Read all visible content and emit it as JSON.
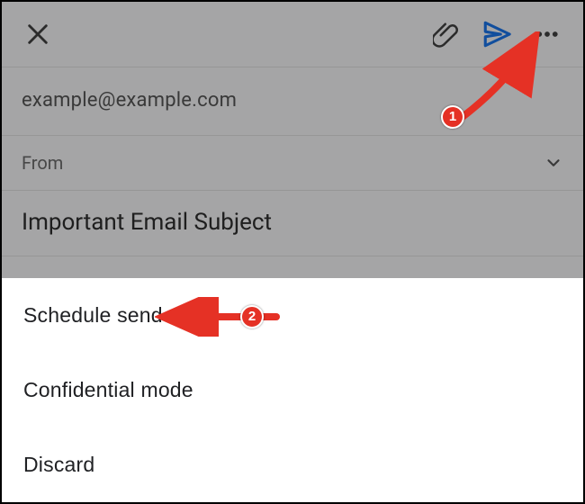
{
  "toolbar": {
    "close_icon": "close",
    "attach_icon": "attachment",
    "send_icon": "send",
    "more_icon": "more"
  },
  "fields": {
    "to": "example@example.com",
    "from_label": "From",
    "subject": "Important Email Subject"
  },
  "menu": {
    "items": [
      {
        "label": "Schedule send"
      },
      {
        "label": "Confidential mode"
      },
      {
        "label": "Discard"
      }
    ]
  },
  "annotations": {
    "step1": "1",
    "step2": "2"
  },
  "colors": {
    "accent_send": "#1a73e8",
    "annotation": "#e53125",
    "icon_dark": "#404040"
  }
}
